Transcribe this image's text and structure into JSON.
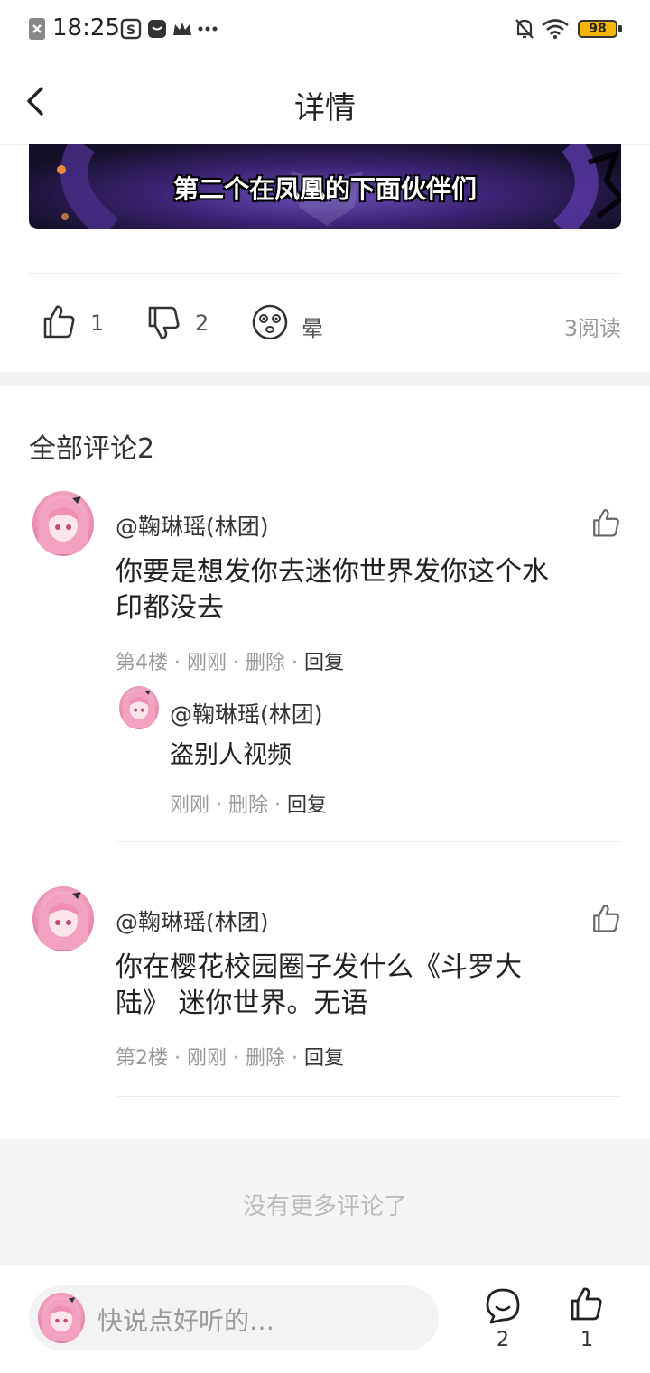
{
  "status_bar": {
    "time": "18:25",
    "battery": "98",
    "icons": [
      "close-box-icon",
      "screenshot-icon",
      "chat-icon",
      "crown-icon",
      "more-dots-icon",
      "mute-bell-icon",
      "wifi-icon",
      "battery-icon"
    ]
  },
  "header": {
    "title": "详情",
    "back_icon": "chevron-left-icon"
  },
  "video": {
    "caption": "第二个在凤凰的下面伙伴们"
  },
  "reactions": {
    "like_count": "1",
    "dislike_count": "2",
    "dizzy_label": "晕",
    "reads": "3阅读"
  },
  "comments": {
    "title": "全部评论2",
    "items": [
      {
        "user": "@鞠琳瑶(林团)",
        "text_line1": "你要是想发你去迷你世界发你这个水",
        "text_line2": "印都没去",
        "floor": "第4楼",
        "time": "刚刚",
        "delete": "删除",
        "reply": "回复",
        "reply_item": {
          "user": "@鞠琳瑶(林团)",
          "text": "盗别人视频",
          "time": "刚刚",
          "delete": "删除",
          "reply": "回复"
        }
      },
      {
        "user": "@鞠琳瑶(林团)",
        "text_line1": "你在樱花校园圈子发什么《斗罗大",
        "text_line2": "陆》 迷你世界。无语",
        "floor": "第2楼",
        "time": "刚刚",
        "delete": "删除",
        "reply": "回复"
      }
    ],
    "no_more": "没有更多评论了"
  },
  "bottom_bar": {
    "input_placeholder": "快说点好听的…",
    "comment_count": "2",
    "like_count": "1"
  },
  "colors": {
    "accent_battery": "#f5b400",
    "text_primary": "#222222",
    "text_secondary": "#999999"
  }
}
